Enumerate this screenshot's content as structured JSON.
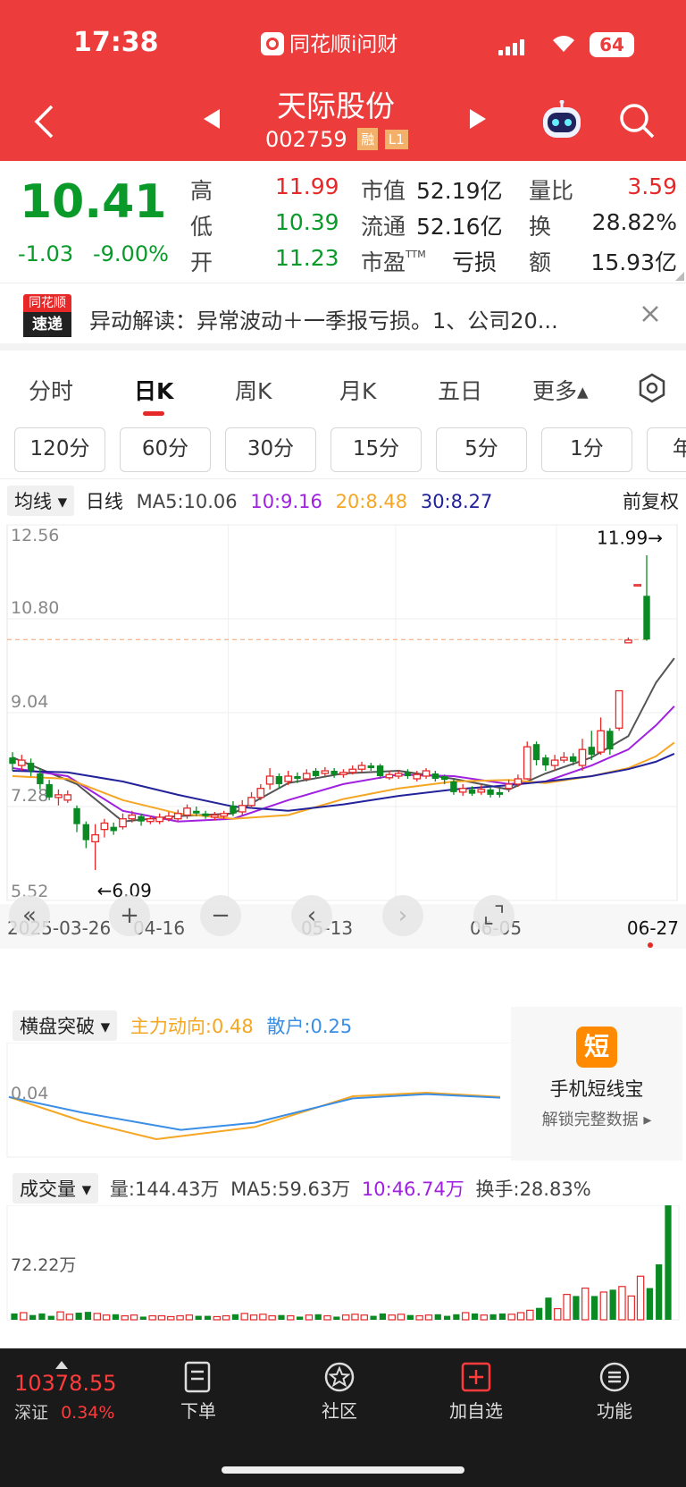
{
  "status_bar": {
    "time": "17:38",
    "app_name": "同花顺i问财",
    "battery": "64"
  },
  "stock": {
    "name": "天际股份",
    "code": "002759",
    "badge_rong": "融",
    "badge_level": "L1"
  },
  "quote": {
    "price": "10.41",
    "change": "-1.03",
    "change_pct": "-9.00%",
    "labels": {
      "high": "高",
      "low": "低",
      "open": "开",
      "mcap": "市值",
      "float": "流通",
      "pe": "市盈",
      "pe_sup": "TTM",
      "vol_ratio": "量比",
      "turnover": "换",
      "amount": "额"
    },
    "high": "11.99",
    "low": "10.39",
    "open": "11.23",
    "mcap": "52.19亿",
    "float": "52.16亿",
    "pe": "亏损",
    "vol_ratio": "3.59",
    "turnover": "28.82%",
    "amount": "15.93亿"
  },
  "news": {
    "logo_top": "同花顺",
    "logo_bottom": "速递",
    "text": "异动解读：异常波动＋一季报亏损。1、公司20..."
  },
  "tabs": [
    {
      "label": "分时"
    },
    {
      "label": "日K"
    },
    {
      "label": "周K"
    },
    {
      "label": "月K"
    },
    {
      "label": "五日"
    },
    {
      "label": "更多▴"
    }
  ],
  "periods": [
    "120分",
    "60分",
    "30分",
    "15分",
    "5分",
    "1分",
    "年"
  ],
  "ma_legend": {
    "selector": "均线",
    "type": "日线",
    "ma5": "MA5:10.06",
    "ma10": "10:9.16",
    "ma20": "20:8.48",
    "ma30": "30:8.27",
    "adjust": "前复权"
  },
  "indicator": {
    "selector": "横盘突破",
    "main": "主力动向:0.48",
    "retail": "散户:0.25",
    "axis": "0.04",
    "promo_title": "手机短线宝",
    "promo_sub": "解锁完整数据 ▸",
    "promo_icon": "短"
  },
  "volume": {
    "selector": "成交量",
    "vol": "量:144.43万",
    "ma5": "MA5:59.63万",
    "ma10": "10:46.74万",
    "turnover": "换手:28.83%",
    "axis": "72.22万"
  },
  "bottom_nav": {
    "index_value": "10378.55",
    "index_name": "深证",
    "index_pct": "0.34%",
    "items": [
      {
        "label": "下单"
      },
      {
        "label": "社区"
      },
      {
        "label": "加自选"
      },
      {
        "label": "功能"
      }
    ]
  },
  "colors": {
    "up": "#e62828",
    "down": "#0a8a22",
    "ma5": "#555555",
    "ma10": "#a020e0",
    "ma20": "#f5a623",
    "ma30": "#22229a",
    "brand": "#ec3c3c"
  },
  "chart_data": {
    "type": "candlestick",
    "y_ticks": [
      "12.56",
      "10.80",
      "9.04",
      "7.28",
      "5.52"
    ],
    "ylim": [
      5.52,
      12.56
    ],
    "x_ticks": [
      "2025-03-26",
      "04-16",
      "05-13",
      "06-05",
      "06-27"
    ],
    "high_label": "11.99→",
    "low_label": "←6.09",
    "ref_price": 10.41,
    "candles": [
      {
        "o": 8.2,
        "c": 8.08,
        "h": 8.3,
        "l": 7.95
      },
      {
        "o": 8.05,
        "c": 8.15,
        "h": 8.25,
        "l": 7.95
      },
      {
        "o": 8.1,
        "c": 7.95,
        "h": 8.18,
        "l": 7.85
      },
      {
        "o": 7.9,
        "c": 7.7,
        "h": 8.0,
        "l": 7.6
      },
      {
        "o": 7.7,
        "c": 7.45,
        "h": 7.78,
        "l": 7.4
      },
      {
        "o": 7.45,
        "c": 7.5,
        "h": 7.6,
        "l": 7.3
      },
      {
        "o": 7.4,
        "c": 7.5,
        "h": 7.58,
        "l": 7.35
      },
      {
        "o": 7.25,
        "c": 6.95,
        "h": 7.3,
        "l": 6.8
      },
      {
        "o": 6.95,
        "c": 6.65,
        "h": 7.0,
        "l": 6.5
      },
      {
        "o": 6.62,
        "c": 6.75,
        "h": 6.95,
        "l": 6.09
      },
      {
        "o": 6.85,
        "c": 6.97,
        "h": 7.05,
        "l": 6.7
      },
      {
        "o": 6.9,
        "c": 6.82,
        "h": 6.98,
        "l": 6.75
      },
      {
        "o": 6.9,
        "c": 7.05,
        "h": 7.15,
        "l": 6.85
      },
      {
        "o": 7.05,
        "c": 7.12,
        "h": 7.2,
        "l": 6.98
      },
      {
        "o": 7.1,
        "c": 7.0,
        "h": 7.15,
        "l": 6.92
      },
      {
        "o": 7.0,
        "c": 7.05,
        "h": 7.1,
        "l": 6.95
      },
      {
        "o": 7.0,
        "c": 7.08,
        "h": 7.15,
        "l": 6.95
      },
      {
        "o": 7.05,
        "c": 7.1,
        "h": 7.18,
        "l": 7.0
      },
      {
        "o": 7.05,
        "c": 7.15,
        "h": 7.22,
        "l": 7.0
      },
      {
        "o": 7.12,
        "c": 7.25,
        "h": 7.32,
        "l": 7.05
      },
      {
        "o": 7.2,
        "c": 7.15,
        "h": 7.28,
        "l": 7.1
      },
      {
        "o": 7.15,
        "c": 7.1,
        "h": 7.2,
        "l": 7.05
      },
      {
        "o": 7.08,
        "c": 7.12,
        "h": 7.18,
        "l": 7.02
      },
      {
        "o": 7.1,
        "c": 7.15,
        "h": 7.2,
        "l": 7.05
      },
      {
        "o": 7.3,
        "c": 7.15,
        "h": 7.38,
        "l": 7.1
      },
      {
        "o": 7.18,
        "c": 7.3,
        "h": 7.4,
        "l": 7.12
      },
      {
        "o": 7.3,
        "c": 7.45,
        "h": 7.55,
        "l": 7.25
      },
      {
        "o": 7.45,
        "c": 7.62,
        "h": 7.7,
        "l": 7.4
      },
      {
        "o": 7.7,
        "c": 7.85,
        "h": 8.0,
        "l": 7.6
      },
      {
        "o": 7.85,
        "c": 7.7,
        "h": 7.9,
        "l": 7.62
      },
      {
        "o": 7.75,
        "c": 7.85,
        "h": 7.95,
        "l": 7.68
      },
      {
        "o": 7.85,
        "c": 7.8,
        "h": 7.92,
        "l": 7.72
      },
      {
        "o": 7.8,
        "c": 7.9,
        "h": 7.98,
        "l": 7.75
      },
      {
        "o": 7.95,
        "c": 7.85,
        "h": 8.0,
        "l": 7.8
      },
      {
        "o": 7.9,
        "c": 7.95,
        "h": 8.02,
        "l": 7.85
      },
      {
        "o": 7.95,
        "c": 7.88,
        "h": 8.0,
        "l": 7.82
      },
      {
        "o": 7.88,
        "c": 7.92,
        "h": 7.98,
        "l": 7.82
      },
      {
        "o": 7.92,
        "c": 7.98,
        "h": 8.05,
        "l": 7.88
      },
      {
        "o": 7.98,
        "c": 8.05,
        "h": 8.12,
        "l": 7.92
      },
      {
        "o": 8.05,
        "c": 8.0,
        "h": 8.1,
        "l": 7.95
      },
      {
        "o": 8.05,
        "c": 7.85,
        "h": 8.08,
        "l": 7.8
      },
      {
        "o": 7.82,
        "c": 7.88,
        "h": 7.95,
        "l": 7.78
      },
      {
        "o": 7.85,
        "c": 7.9,
        "h": 7.96,
        "l": 7.8
      },
      {
        "o": 7.92,
        "c": 7.85,
        "h": 7.98,
        "l": 7.8
      },
      {
        "o": 7.8,
        "c": 7.88,
        "h": 7.95,
        "l": 7.75
      },
      {
        "o": 7.85,
        "c": 7.95,
        "h": 8.0,
        "l": 7.8
      },
      {
        "o": 7.9,
        "c": 7.8,
        "h": 7.95,
        "l": 7.75
      },
      {
        "o": 7.85,
        "c": 7.78,
        "h": 7.88,
        "l": 7.7
      },
      {
        "o": 7.75,
        "c": 7.55,
        "h": 7.8,
        "l": 7.5
      },
      {
        "o": 7.55,
        "c": 7.62,
        "h": 7.7,
        "l": 7.48
      },
      {
        "o": 7.6,
        "c": 7.52,
        "h": 7.66,
        "l": 7.48
      },
      {
        "o": 7.55,
        "c": 7.6,
        "h": 7.68,
        "l": 7.5
      },
      {
        "o": 7.6,
        "c": 7.5,
        "h": 7.65,
        "l": 7.45
      },
      {
        "o": 7.55,
        "c": 7.5,
        "h": 7.62,
        "l": 7.45
      },
      {
        "o": 7.62,
        "c": 7.7,
        "h": 7.78,
        "l": 7.55
      },
      {
        "o": 7.7,
        "c": 7.8,
        "h": 7.88,
        "l": 7.65
      },
      {
        "o": 7.8,
        "c": 8.4,
        "h": 8.5,
        "l": 7.78
      },
      {
        "o": 8.45,
        "c": 8.15,
        "h": 8.5,
        "l": 8.05
      },
      {
        "o": 8.2,
        "c": 8.05,
        "h": 8.25,
        "l": 7.95
      },
      {
        "o": 8.05,
        "c": 8.15,
        "h": 8.25,
        "l": 7.95
      },
      {
        "o": 8.15,
        "c": 8.2,
        "h": 8.3,
        "l": 8.1
      },
      {
        "o": 8.22,
        "c": 8.12,
        "h": 8.28,
        "l": 8.05
      },
      {
        "o": 8.05,
        "c": 8.35,
        "h": 8.55,
        "l": 7.95
      },
      {
        "o": 8.4,
        "c": 8.25,
        "h": 8.7,
        "l": 8.15
      },
      {
        "o": 8.3,
        "c": 8.7,
        "h": 8.95,
        "l": 8.25
      },
      {
        "o": 8.7,
        "c": 8.35,
        "h": 8.75,
        "l": 8.25
      },
      {
        "o": 8.75,
        "c": 9.45,
        "h": 9.45,
        "l": 8.7
      },
      {
        "o": 10.35,
        "c": 10.4,
        "h": 10.45,
        "l": 10.35
      },
      {
        "o": 11.44,
        "c": 11.44,
        "h": 11.44,
        "l": 11.44
      },
      {
        "o": 11.23,
        "c": 10.41,
        "h": 11.99,
        "l": 10.39
      }
    ],
    "series": [
      {
        "key": "ma5",
        "points": [
          [
            0,
            8.2
          ],
          [
            7,
            7.7
          ],
          [
            12,
            7.0
          ],
          [
            18,
            7.1
          ],
          [
            24,
            7.15
          ],
          [
            30,
            7.72
          ],
          [
            36,
            7.9
          ],
          [
            42,
            7.95
          ],
          [
            48,
            7.8
          ],
          [
            54,
            7.6
          ],
          [
            58,
            7.9
          ],
          [
            63,
            8.2
          ],
          [
            67,
            8.6
          ],
          [
            70,
            9.6
          ],
          [
            72,
            10.06
          ]
        ]
      },
      {
        "key": "ma10",
        "points": [
          [
            0,
            8.0
          ],
          [
            6,
            7.85
          ],
          [
            12,
            7.2
          ],
          [
            18,
            7.0
          ],
          [
            24,
            7.05
          ],
          [
            30,
            7.4
          ],
          [
            36,
            7.7
          ],
          [
            42,
            7.88
          ],
          [
            48,
            7.85
          ],
          [
            54,
            7.7
          ],
          [
            58,
            7.75
          ],
          [
            63,
            8.05
          ],
          [
            67,
            8.35
          ],
          [
            70,
            8.8
          ],
          [
            72,
            9.16
          ]
        ]
      },
      {
        "key": "ma20",
        "points": [
          [
            0,
            7.85
          ],
          [
            6,
            7.8
          ],
          [
            12,
            7.4
          ],
          [
            18,
            7.15
          ],
          [
            24,
            7.05
          ],
          [
            30,
            7.12
          ],
          [
            36,
            7.42
          ],
          [
            42,
            7.62
          ],
          [
            48,
            7.75
          ],
          [
            54,
            7.78
          ],
          [
            58,
            7.72
          ],
          [
            63,
            7.85
          ],
          [
            67,
            8.0
          ],
          [
            70,
            8.22
          ],
          [
            72,
            8.48
          ]
        ]
      },
      {
        "key": "ma30",
        "points": [
          [
            0,
            7.95
          ],
          [
            6,
            7.92
          ],
          [
            12,
            7.75
          ],
          [
            18,
            7.5
          ],
          [
            24,
            7.28
          ],
          [
            30,
            7.2
          ],
          [
            36,
            7.32
          ],
          [
            42,
            7.48
          ],
          [
            48,
            7.6
          ],
          [
            54,
            7.68
          ],
          [
            58,
            7.75
          ],
          [
            63,
            7.85
          ],
          [
            67,
            7.98
          ],
          [
            70,
            8.12
          ],
          [
            72,
            8.27
          ]
        ]
      }
    ]
  },
  "indicator_data": {
    "main": [
      [
        0,
        0.04
      ],
      [
        0.15,
        -0.3
      ],
      [
        0.3,
        -0.55
      ],
      [
        0.5,
        -0.38
      ],
      [
        0.7,
        0.05
      ],
      [
        0.85,
        0.1
      ],
      [
        1,
        0.04
      ]
    ],
    "retail": [
      [
        0,
        0.04
      ],
      [
        0.15,
        -0.18
      ],
      [
        0.35,
        -0.42
      ],
      [
        0.5,
        -0.32
      ],
      [
        0.7,
        0.02
      ],
      [
        0.85,
        0.08
      ],
      [
        1,
        0.03
      ]
    ]
  },
  "volume_data": {
    "vmax": 144.43,
    "bars": [
      8,
      9,
      6,
      8,
      5,
      10,
      7,
      9,
      10,
      8,
      6,
      7,
      5,
      6,
      4,
      5,
      5,
      4,
      5,
      6,
      5,
      5,
      4,
      5,
      7,
      8,
      6,
      7,
      5,
      6,
      5,
      4,
      6,
      7,
      5,
      4,
      6,
      7,
      6,
      5,
      8,
      6,
      7,
      6,
      5,
      6,
      7,
      5,
      7,
      9,
      8,
      6,
      7,
      8,
      7,
      9,
      12,
      15,
      28,
      14,
      32,
      30,
      40,
      30,
      35,
      38,
      42,
      30,
      55,
      40,
      70,
      144.43
    ]
  }
}
